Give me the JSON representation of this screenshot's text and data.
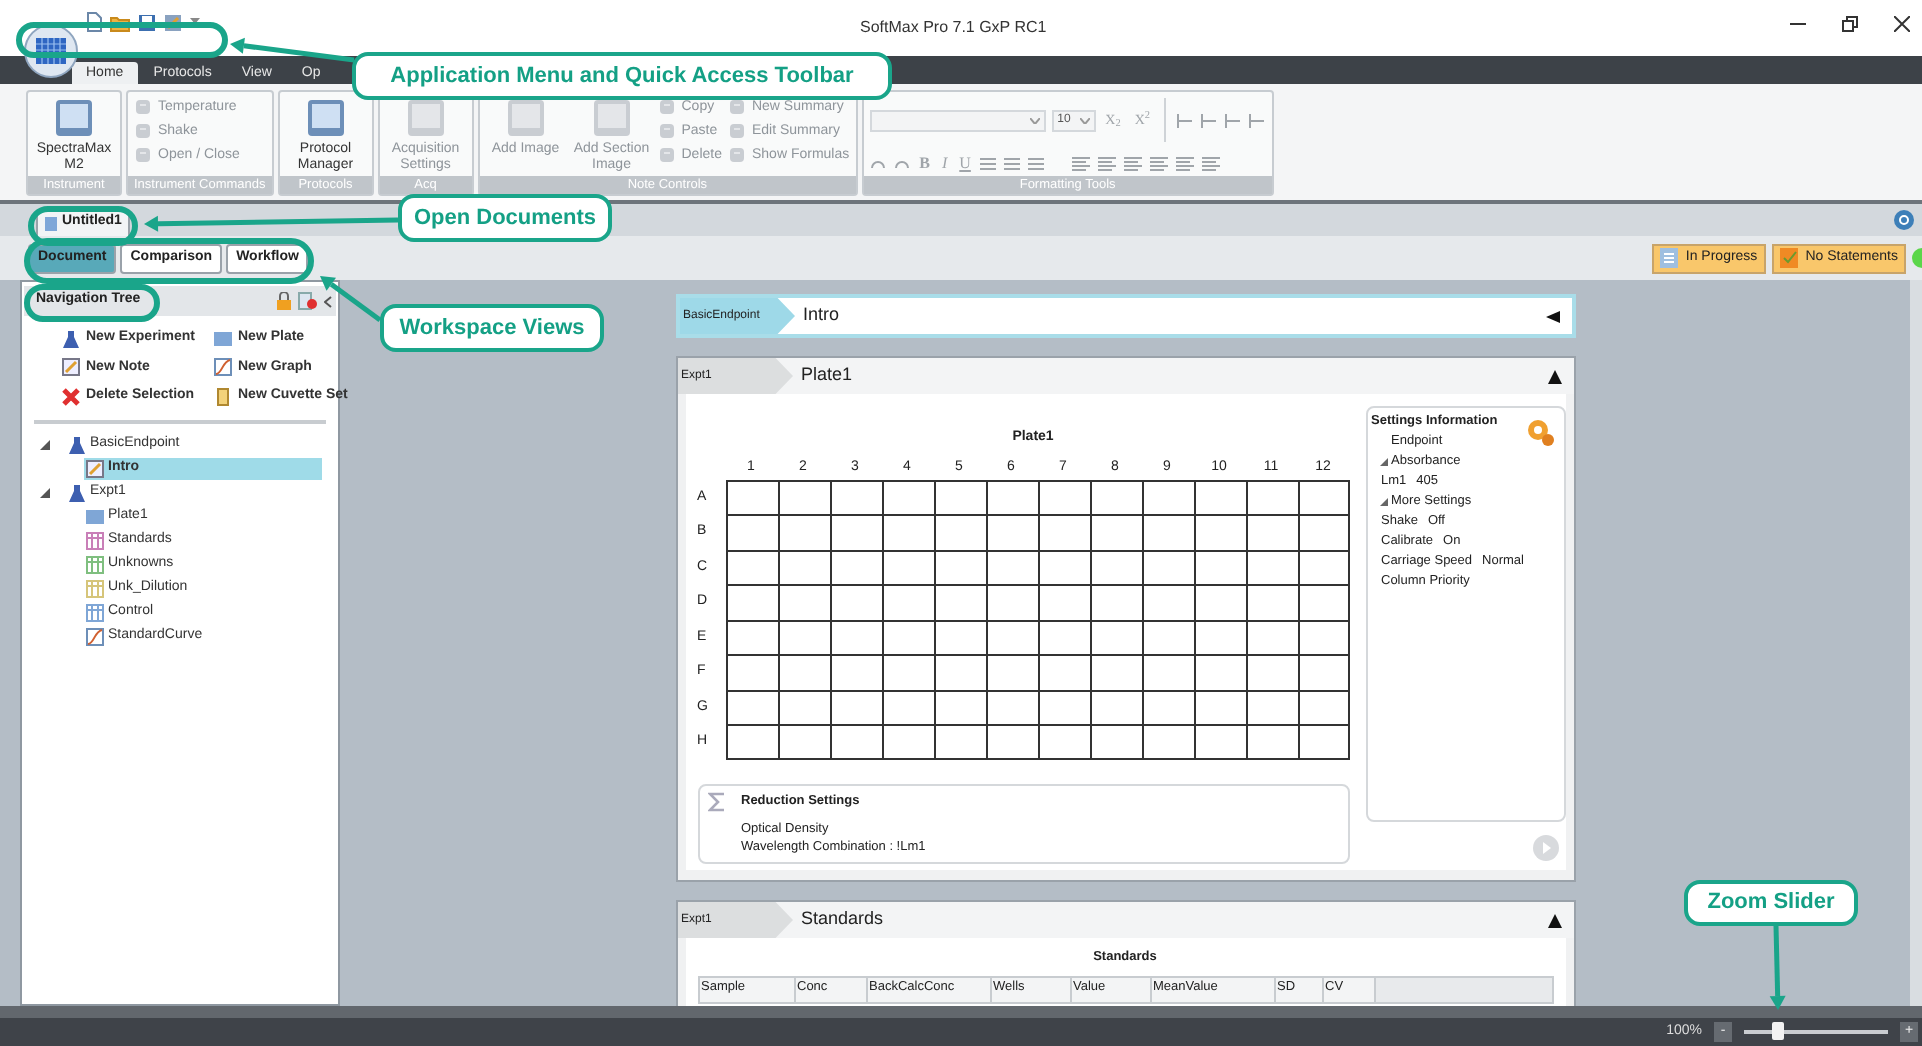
{
  "window": {
    "title": "SoftMax Pro 7.1 GxP RC1"
  },
  "ribbon": {
    "tabs": [
      {
        "label": "Home",
        "selected": true
      },
      {
        "label": "Protocols",
        "selected": false
      },
      {
        "label": "View",
        "selected": false
      },
      {
        "label": "Op",
        "selected": false
      }
    ],
    "groups": [
      {
        "label": "Instrument",
        "items": [
          {
            "kind": "large",
            "label": "SpectraMax M2",
            "disabled": false
          }
        ]
      },
      {
        "label": "Instrument Commands",
        "items": [
          {
            "kind": "small",
            "label": "Temperature",
            "disabled": true
          },
          {
            "kind": "small",
            "label": "Shake",
            "disabled": true
          },
          {
            "kind": "small",
            "label": "Open / Close",
            "disabled": true
          }
        ]
      },
      {
        "label": "Protocols",
        "items": [
          {
            "kind": "large",
            "label": "Protocol Manager",
            "disabled": false
          }
        ]
      },
      {
        "label": "Acq",
        "items": [
          {
            "kind": "large",
            "label": "Acquisition Settings",
            "disabled": true
          }
        ]
      },
      {
        "label": "Note Controls",
        "items": [
          {
            "kind": "large",
            "label": "Add Image",
            "disabled": true
          },
          {
            "kind": "large",
            "label": "Add Section Image",
            "disabled": true
          },
          {
            "kind": "small",
            "label": "Copy",
            "disabled": true
          },
          {
            "kind": "small",
            "label": "Paste",
            "disabled": true
          },
          {
            "kind": "small",
            "label": "Delete",
            "disabled": true
          },
          {
            "kind": "small",
            "label": "New Summary",
            "disabled": true
          },
          {
            "kind": "small",
            "label": "Edit Summary",
            "disabled": true
          },
          {
            "kind": "small",
            "label": "Show Formulas",
            "disabled": true
          }
        ]
      },
      {
        "label": "Formatting Tools",
        "kind": "formatting",
        "font_size": "10",
        "script_buttons": [
          "X$_{2}$",
          "X$^{2}$"
        ],
        "style_buttons": [
          "B",
          "I",
          "U"
        ]
      }
    ]
  },
  "documents": [
    {
      "label": "Untitled1",
      "selected": true
    }
  ],
  "workspace_tabs": [
    {
      "label": "Document",
      "selected": true
    },
    {
      "label": "Comparison",
      "selected": false
    },
    {
      "label": "Workflow",
      "selected": false
    }
  ],
  "status_badges": [
    {
      "label": "In Progress"
    },
    {
      "label": "No Statements"
    }
  ],
  "navigation": {
    "title": "Navigation Tree",
    "actions": [
      {
        "kind": "experiment",
        "label": "New Experiment"
      },
      {
        "kind": "plate",
        "label": "New Plate"
      },
      {
        "kind": "note",
        "label": "New Note"
      },
      {
        "kind": "graph",
        "label": "New Graph"
      },
      {
        "kind": "delete",
        "label": "Delete Selection"
      },
      {
        "kind": "cuvette",
        "label": "New Cuvette Set"
      }
    ],
    "tree": [
      {
        "kind": "experiment",
        "label": "BasicEndpoint",
        "expanded": true,
        "selected": false,
        "children": [
          {
            "kind": "note",
            "label": "Intro",
            "selected": true
          }
        ]
      },
      {
        "kind": "experiment",
        "label": "Expt1",
        "expanded": true,
        "selected": false,
        "children": [
          {
            "kind": "plate",
            "label": "Plate1",
            "selected": false
          },
          {
            "kind": "group",
            "label": "Standards",
            "color": "#c97fb8",
            "selected": false
          },
          {
            "kind": "group",
            "label": "Unknowns",
            "color": "#7fbf7f",
            "selected": false
          },
          {
            "kind": "group",
            "label": "Unk_Dilution",
            "color": "#d6c57a",
            "selected": false
          },
          {
            "kind": "group",
            "label": "Control",
            "color": "#7fa6d6",
            "selected": false
          },
          {
            "kind": "graph",
            "label": "StandardCurve",
            "selected": false
          }
        ]
      }
    ]
  },
  "sections": [
    {
      "kind": "note",
      "experiment": "BasicEndpoint",
      "title": "Intro",
      "selected": true,
      "expanded": false
    },
    {
      "kind": "plate",
      "experiment": "Expt1",
      "title": "Plate1",
      "selected": false,
      "expanded": true,
      "plate": {
        "title": "Plate1",
        "columns": [
          "1",
          "2",
          "3",
          "4",
          "5",
          "6",
          "7",
          "8",
          "9",
          "10",
          "11",
          "12"
        ],
        "rows": [
          "A",
          "B",
          "C",
          "D",
          "E",
          "F",
          "G",
          "H"
        ]
      },
      "settings": {
        "title": "Settings Information",
        "items": [
          {
            "label": "Endpoint"
          },
          {
            "label": "Absorbance",
            "expanded": true,
            "children": [
              {
                "label": "Lm1",
                "value": "405"
              }
            ]
          },
          {
            "label": "More Settings",
            "expanded": true,
            "children": [
              {
                "label": "Shake",
                "value": "Off"
              },
              {
                "label": "Calibrate",
                "value": "On"
              },
              {
                "label": "Carriage Speed",
                "value": "Normal"
              },
              {
                "label": "Column Priority"
              }
            ]
          }
        ]
      },
      "reduction": {
        "title": "Reduction Settings",
        "lines": [
          "Optical Density",
          "Wavelength Combination : !Lm1"
        ]
      }
    },
    {
      "kind": "table",
      "experiment": "Expt1",
      "title": "Standards",
      "selected": false,
      "expanded": true,
      "table": {
        "title": "Standards",
        "columns": [
          "Sample",
          "Conc",
          "BackCalcConc",
          "Wells",
          "Value",
          "MeanValue",
          "SD",
          "CV"
        ]
      }
    }
  ],
  "status_bar": {
    "zoom": "100%",
    "zoom_out": "-",
    "zoom_in": "+",
    "level": 0.23
  },
  "callouts": [
    {
      "text": "Application Menu and Quick Access Toolbar"
    },
    {
      "text": "Open Documents"
    },
    {
      "text": "Workspace Views"
    },
    {
      "text": "Zoom Slider"
    }
  ]
}
